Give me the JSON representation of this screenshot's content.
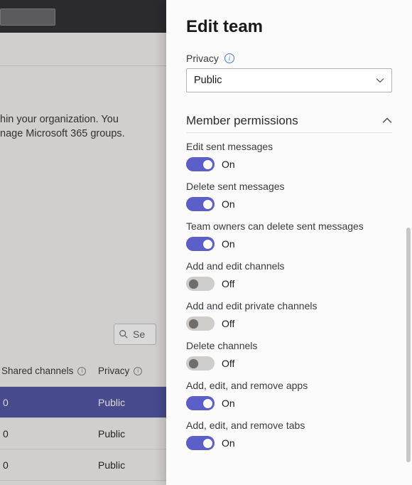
{
  "background": {
    "description_line1": "hin your organization. You",
    "description_line2": "nage Microsoft 365 groups.",
    "search_placeholder": "Se",
    "table": {
      "col1": "Shared channels",
      "col2": "Privacy",
      "rows": [
        {
          "shared": "0",
          "privacy": "Public",
          "selected": true
        },
        {
          "shared": "0",
          "privacy": "Public",
          "selected": false
        },
        {
          "shared": "0",
          "privacy": "Public",
          "selected": false
        }
      ]
    }
  },
  "panel": {
    "title": "Edit team",
    "privacy_label": "Privacy",
    "privacy_value": "Public",
    "section_title": "Member permissions",
    "on_label": "On",
    "off_label": "Off",
    "permissions": [
      {
        "label": "Edit sent messages",
        "value": true
      },
      {
        "label": "Delete sent messages",
        "value": true
      },
      {
        "label": "Team owners can delete sent messages",
        "value": true
      },
      {
        "label": "Add and edit channels",
        "value": false
      },
      {
        "label": "Add and edit private channels",
        "value": false
      },
      {
        "label": "Delete channels",
        "value": false
      },
      {
        "label": "Add, edit, and remove apps",
        "value": true
      },
      {
        "label": "Add, edit, and remove tabs",
        "value": true
      }
    ]
  }
}
